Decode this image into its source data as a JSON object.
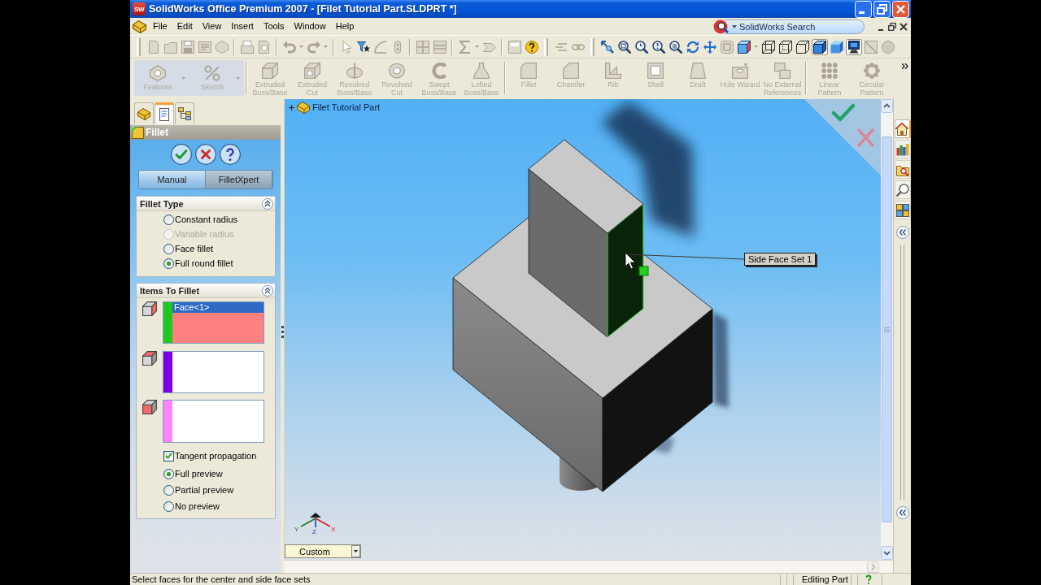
{
  "window": {
    "logo": "SW",
    "title": "SolidWorks Office Premium 2007 - [Filet Tutorial Part.SLDPRT *]"
  },
  "menu": [
    "File",
    "Edit",
    "View",
    "Insert",
    "Tools",
    "Window",
    "Help"
  ],
  "search": {
    "placeholder": "SolidWorks Search"
  },
  "view_toolbar": {
    "display_buttons": [
      {
        "kind": "wireframe",
        "selected": false
      },
      {
        "kind": "hidden-visible",
        "selected": false
      },
      {
        "kind": "hidden-removed",
        "selected": false
      },
      {
        "kind": "shaded-edges",
        "selected": true
      },
      {
        "kind": "shaded",
        "selected": false
      },
      {
        "kind": "shadows",
        "selected": true
      }
    ]
  },
  "command_manager": {
    "tabs": [
      {
        "label": "Features",
        "disabled": true
      },
      {
        "label": "Sketch",
        "disabled": true
      }
    ],
    "groups": [
      [
        {
          "label": "Extruded Boss/Base",
          "disabled": true
        },
        {
          "label": "Extruded Cut",
          "disabled": true
        },
        {
          "label": "Revolved Boss/Base",
          "disabled": true
        },
        {
          "label": "Revolved Cut",
          "disabled": true
        },
        {
          "label": "Swept Boss/Base",
          "disabled": true
        },
        {
          "label": "Lofted Boss/Base",
          "disabled": true
        }
      ],
      [
        {
          "label": "Fillet",
          "disabled": true
        },
        {
          "label": "Chamfer",
          "disabled": true
        },
        {
          "label": "Rib",
          "disabled": true
        },
        {
          "label": "Shell",
          "disabled": true
        },
        {
          "label": "Draft",
          "disabled": true
        },
        {
          "label": "Hole Wizard",
          "disabled": true
        },
        {
          "label": "No External References",
          "disabled": true
        }
      ],
      [
        {
          "label": "Linear Pattern",
          "disabled": true
        },
        {
          "label": "Circular Pattern",
          "disabled": true
        }
      ]
    ]
  },
  "panel_tabs": [
    {
      "kind": "feature-tree",
      "selected": false
    },
    {
      "kind": "property-manager",
      "selected": true
    },
    {
      "kind": "configuration",
      "selected": false
    }
  ],
  "property_manager": {
    "title": "Fillet",
    "modes": [
      {
        "label": "Manual",
        "selected": true
      },
      {
        "label": "FilletXpert",
        "selected": false
      }
    ],
    "fillet_type": {
      "title": "Fillet Type",
      "expanded": true,
      "options": [
        {
          "label": "Constant radius",
          "selected": false,
          "disabled": false
        },
        {
          "label": "Variable radius",
          "selected": false,
          "disabled": true
        },
        {
          "label": "Face fillet",
          "selected": false,
          "disabled": false
        },
        {
          "label": "Full round fillet",
          "selected": true,
          "disabled": false
        }
      ]
    },
    "items_to_fillet": {
      "title": "Items To Fillet",
      "expanded": true,
      "face_sets": [
        {
          "color": "#1ec81e",
          "active": true,
          "items": [
            {
              "label": "Face<1>",
              "selected": true
            }
          ]
        },
        {
          "color": "#7a00e6",
          "active": false
        },
        {
          "color": "#ff84ff",
          "active": false
        }
      ],
      "tangent_propagation": {
        "label": "Tangent propagation",
        "checked": true
      },
      "preview": [
        {
          "label": "Full preview",
          "selected": true
        },
        {
          "label": "Partial preview",
          "selected": false
        },
        {
          "label": "No preview",
          "selected": false
        }
      ]
    }
  },
  "viewport": {
    "tree_root": {
      "label": "Filet Tutorial Part",
      "expanded": false
    },
    "callout": {
      "label": "Side Face Set 1"
    },
    "triad_labels": [
      "Y",
      "Z",
      "X"
    ],
    "orientation": {
      "value": "Custom"
    }
  },
  "task_pane": {
    "tabs": [
      {
        "kind": "home",
        "selected": true
      },
      {
        "kind": "library",
        "selected": false
      },
      {
        "kind": "file-explorer",
        "selected": false
      },
      {
        "kind": "search",
        "selected": false
      },
      {
        "kind": "palette",
        "selected": false
      }
    ]
  },
  "status_bar": {
    "message": "Select faces for the center and side face sets",
    "mode": "Editing Part"
  }
}
